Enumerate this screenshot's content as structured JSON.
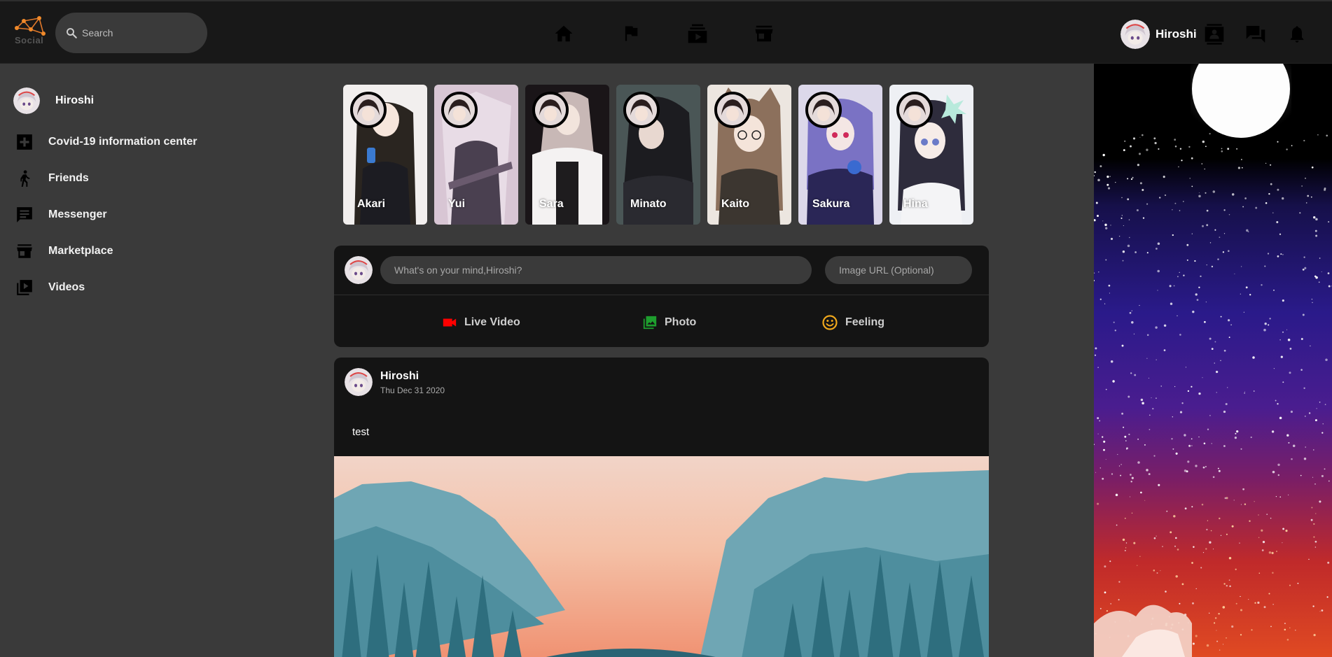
{
  "header": {
    "logo_text": "Social",
    "search_placeholder": "Search",
    "nav_icons": [
      "home-icon",
      "flag-icon",
      "subscriptions-icon",
      "storefront-icon"
    ],
    "user_name": "Hiroshi",
    "right_icons": [
      "contact-card-icon",
      "chat-icon",
      "bell-icon"
    ]
  },
  "sidebar": {
    "user_name": "Hiroshi",
    "items": [
      {
        "label": "Covid-19 information center",
        "icon": "medical-plus-icon"
      },
      {
        "label": "Friends",
        "icon": "person-walking-icon"
      },
      {
        "label": "Messenger",
        "icon": "chat-icon"
      },
      {
        "label": "Marketplace",
        "icon": "storefront-icon"
      },
      {
        "label": "Videos",
        "icon": "video-library-icon"
      }
    ]
  },
  "stories": [
    {
      "name": "Akari",
      "color": "#2b2a30"
    },
    {
      "name": "Yui",
      "color": "#c8b2c8"
    },
    {
      "name": "Sara",
      "color": "#d8d2d6"
    },
    {
      "name": "Minato",
      "color": "#3c4446"
    },
    {
      "name": "Kaito",
      "color": "#9c8a7c"
    },
    {
      "name": "Sakura",
      "color": "#5a4a9a"
    },
    {
      "name": "Hina",
      "color": "#d6dce8"
    }
  ],
  "composer": {
    "placeholder": "What's on your mind,Hiroshi?",
    "image_url_placeholder": "Image URL (Optional)",
    "options": [
      {
        "label": "Live Video",
        "icon": "videocam-icon",
        "color": "#ff0000"
      },
      {
        "label": "Photo",
        "icon": "photo-library-icon",
        "color": "#1e9e2e"
      },
      {
        "label": "Feeling",
        "icon": "smiley-icon",
        "color": "#f0a81c"
      }
    ]
  },
  "post": {
    "author": "Hiroshi",
    "date": "Thu Dec 31 2020",
    "text": "test"
  },
  "colors": {
    "background": "#3a3a3a",
    "header": "#181818",
    "card": "#141414",
    "input": "#3a3a3a"
  }
}
